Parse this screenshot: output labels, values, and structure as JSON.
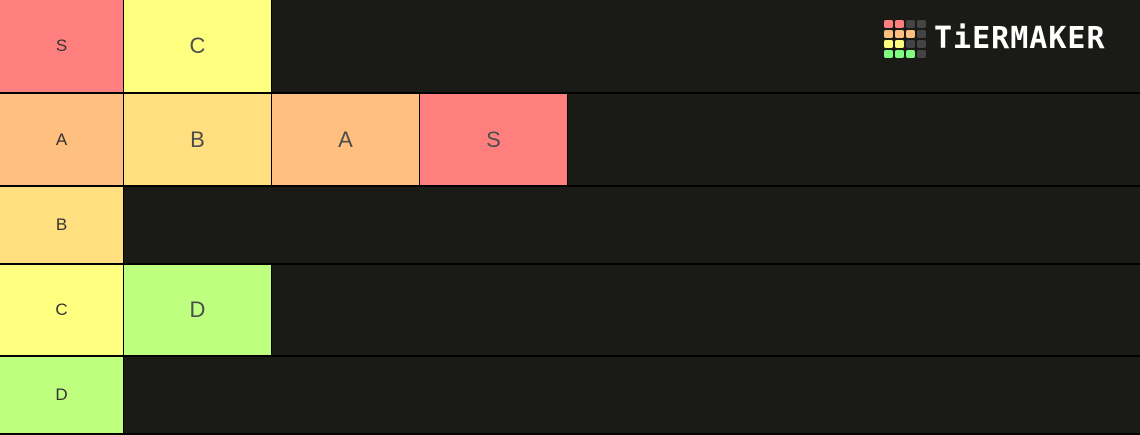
{
  "colors": {
    "S": "#ff7f7f",
    "A": "#ffbf7f",
    "B": "#ffdf80",
    "C": "#ffff7f",
    "D": "#bfff7f",
    "row_bg": "#1a1a17"
  },
  "logo": {
    "text": "TiERMAKER",
    "grid_colors": [
      "#ff7f7f",
      "#ff7f7f",
      "#444444",
      "#444444",
      "#ffbf7f",
      "#ffbf7f",
      "#ffbf7f",
      "#444444",
      "#ffff7f",
      "#ffff7f",
      "#444444",
      "#444444",
      "#7fff7f",
      "#7fff7f",
      "#7fff7f",
      "#444444"
    ]
  },
  "tiers": [
    {
      "label": "S",
      "items": [
        "C"
      ]
    },
    {
      "label": "A",
      "items": [
        "B",
        "A",
        "S"
      ]
    },
    {
      "label": "B",
      "items": []
    },
    {
      "label": "C",
      "items": [
        "D"
      ]
    },
    {
      "label": "D",
      "items": []
    }
  ]
}
